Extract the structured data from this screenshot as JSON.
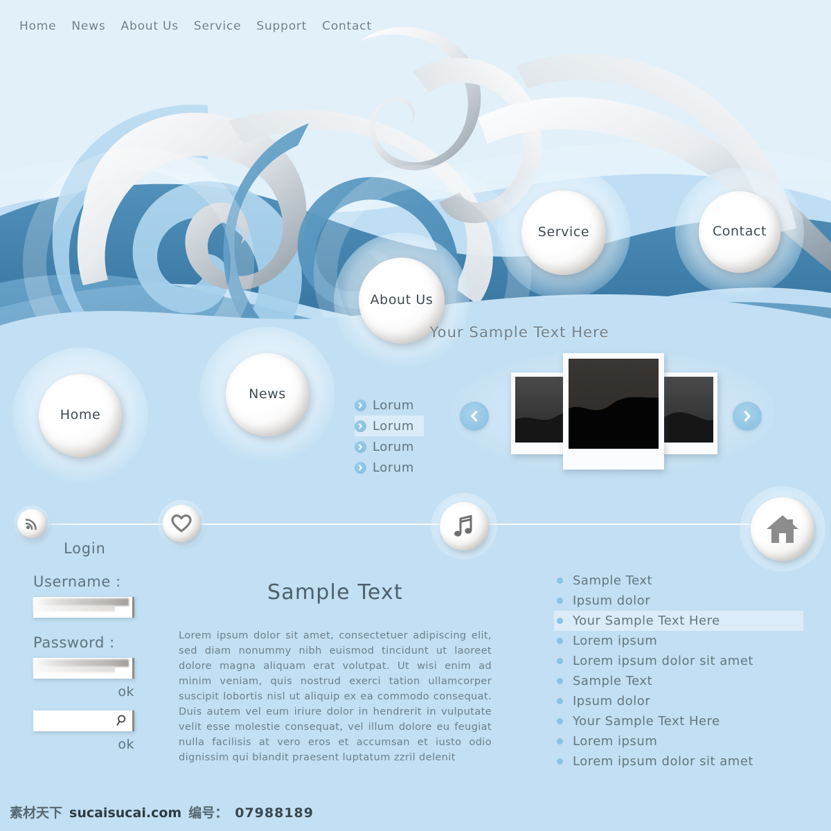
{
  "colors": {
    "page_bg": "#c2dff3",
    "top_bg": "#e2f0f9",
    "wave_deep_blue": "#3b7fac",
    "wave_mid_blue": "#5b9bc4",
    "wave_light_blue": "#a9d4ed",
    "wave_pale": "#d6ebf8",
    "text_grey": "#6d808c",
    "accent_blue": "#86bedf"
  },
  "topnav": {
    "items": [
      {
        "label": "Home"
      },
      {
        "label": "News"
      },
      {
        "label": "About Us"
      },
      {
        "label": "Service"
      },
      {
        "label": "Support"
      },
      {
        "label": "Contact"
      }
    ]
  },
  "bubbles": [
    {
      "label": "Home"
    },
    {
      "label": "News"
    },
    {
      "label": "About Us"
    },
    {
      "label": "Service"
    },
    {
      "label": "Contact"
    }
  ],
  "hero": {
    "heading": "Your Sample Text Here"
  },
  "lorum_list": {
    "items": [
      {
        "label": "Lorum",
        "highlighted": false
      },
      {
        "label": "Lorum",
        "highlighted": true
      },
      {
        "label": "Lorum",
        "highlighted": false
      },
      {
        "label": "Lorum",
        "highlighted": false
      }
    ]
  },
  "carousel": {
    "prev_icon": "chevron-left-icon",
    "next_icon": "chevron-right-icon",
    "slides": 3
  },
  "rail": {
    "icons": [
      {
        "name": "rss-icon"
      },
      {
        "name": "heart-icon"
      },
      {
        "name": "music-note-icon"
      },
      {
        "name": "home-icon"
      }
    ]
  },
  "login": {
    "title": "Login",
    "username_label": "Username :",
    "username_value": "",
    "username_placeholder": "",
    "password_label": "Password :",
    "password_value": "",
    "password_placeholder": "",
    "ok_label_1": "ok",
    "search_value": "",
    "search_placeholder": "",
    "search_icon": "magnifier-icon",
    "ok_label_2": "ok"
  },
  "article": {
    "heading": "Sample Text",
    "body": "Lorem ipsum dolor sit amet, consectetuer adipiscing elit, sed diam nonummy nibh euismod tincidunt ut laoreet dolore magna aliquam erat volutpat. Ut wisi enim ad minim veniam, quis nostrud exerci tation ullamcorper suscipit lobortis nisl ut aliquip ex ea commodo consequat. Duis autem vel eum iriure dolor in hendrerit in vulputate velit esse molestie consequat, vel illum dolore eu feugiat nulla facilisis at vero eros et accumsan et iusto odio dignissim qui blandit praesent luptatum zzril delenit"
  },
  "links": {
    "items": [
      {
        "label": "Sample Text",
        "highlighted": false
      },
      {
        "label": "Ipsum dolor",
        "highlighted": false
      },
      {
        "label": "Your Sample Text Here",
        "highlighted": true
      },
      {
        "label": "Lorem ipsum",
        "highlighted": false
      },
      {
        "label": "Lorem ipsum dolor sit amet",
        "highlighted": false
      },
      {
        "label": "Sample Text",
        "highlighted": false
      },
      {
        "label": "Ipsum dolor",
        "highlighted": false
      },
      {
        "label": "Your Sample Text Here",
        "highlighted": false
      },
      {
        "label": "Lorem ipsum",
        "highlighted": false
      },
      {
        "label": "Lorem ipsum dolor sit amet",
        "highlighted": false
      }
    ]
  },
  "watermark": {
    "brand_cn": "素材天下",
    "domain": "sucaisucai.com",
    "id_label": "编号：",
    "id_value": "07988189"
  }
}
